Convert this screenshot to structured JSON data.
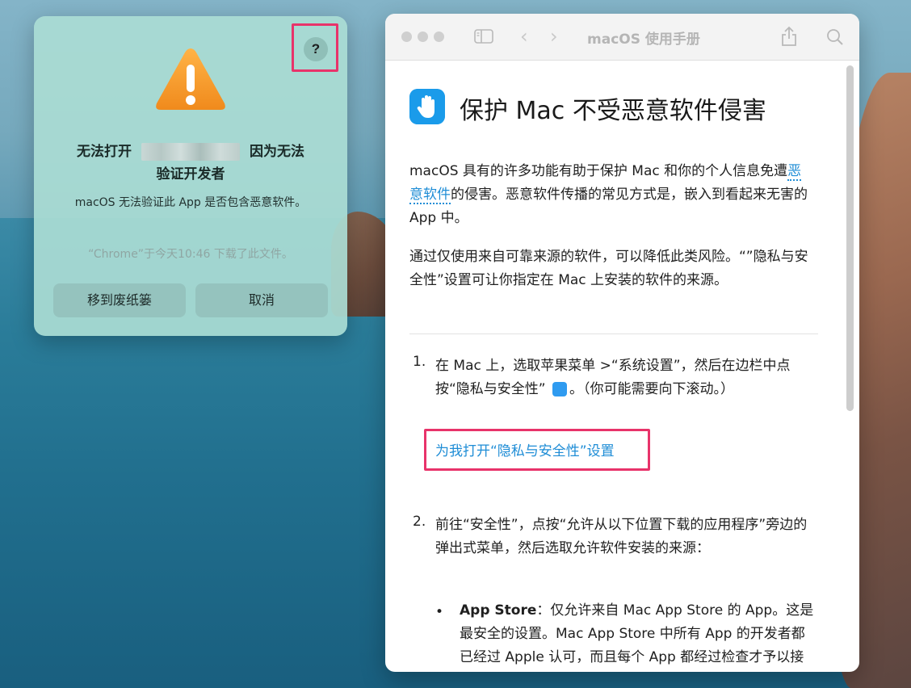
{
  "alert": {
    "title_line1_left": "无法打开",
    "title_line1_right": "因为无法",
    "title_line2": "验证开发者",
    "body": "macOS 无法验证此 App 是否包含恶意软件。",
    "download_note": "“Chrome”于今天10:46 下载了此文件。",
    "help_label": "?",
    "trash_button": "移到废纸篓",
    "cancel_button": "取消"
  },
  "help": {
    "window_title": "macOS 使用手册",
    "page_title": "保护 Mac 不受恶意软件侵害",
    "intro_part1": "macOS 具有的许多功能有助于保护 Mac 和你的个人信息免遭",
    "intro_link": "恶意软件",
    "intro_part2": "的侵害。恶意软件传播的常见方式是，嵌入到看起来无害的 App 中。",
    "para2": "通过仅使用来自可靠来源的软件，可以降低此类风险。“”隐私与安全性”设置可让你指定在 Mac 上安装的软件的来源。",
    "step1_num": "1.",
    "step1_part1": "在 Mac 上，选取苹果菜单",
    "step1_apple": "",
    "step1_part2": ">“系统设置”，然后在边栏中点按“隐私与安全性”",
    "step1_part3": "。（你可能需要向下滚动。）",
    "open_settings_link": "为我打开“隐私与安全性”设置",
    "step2_num": "2.",
    "step2_text": "前往“安全性”，点按“允许从以下位置下载的应用程序”旁边的弹出式菜单，然后选取允许软件安装的来源：",
    "bullet_mark": "•",
    "bullet_bold": "App Store",
    "bullet_text": "：仅允许来自 Mac App Store 的 App。这是最安全的设置。Mac App Store 中所有 App 的开发者都已经过 Apple 认可，而且每个 App 都经过检查才予以接纳。macOS 会在 App 初次运行前进行检查，以确保 App 并未在开发者发布后被修"
  },
  "colors": {
    "accent_link": "#1f8dd6",
    "highlight": "#e8336a",
    "warning": "#f5a623"
  }
}
